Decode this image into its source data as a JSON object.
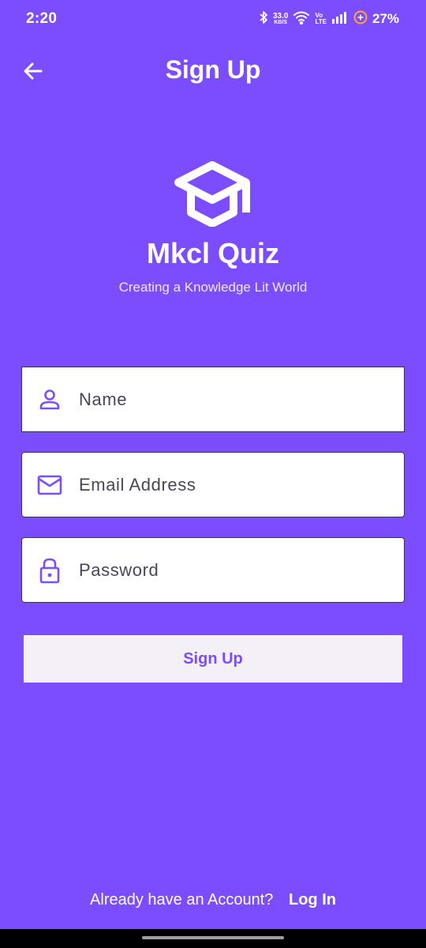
{
  "status_bar": {
    "time": "2:20",
    "net_speed": "33.0",
    "net_speed_unit": "KB/S",
    "volte_top": "Vo",
    "volte_bottom": "LTE",
    "battery": "27%",
    "icons": [
      "bluetooth-icon",
      "wifi-icon",
      "volte-icon",
      "signal-icon",
      "battery-saver-icon"
    ]
  },
  "app_bar": {
    "back_icon": "arrow-left-icon",
    "title": "Sign Up"
  },
  "brand": {
    "logo_icon": "graduation-cap-icon",
    "name": "Mkcl Quiz",
    "tagline": "Creating a Knowledge Lit World"
  },
  "form": {
    "name": {
      "placeholder": "Name",
      "value": "",
      "icon": "person-icon"
    },
    "email": {
      "placeholder": "Email Address",
      "value": "",
      "icon": "mail-icon"
    },
    "password": {
      "placeholder": "Password",
      "value": "",
      "icon": "lock-icon"
    },
    "submit_label": "Sign Up"
  },
  "footer": {
    "question": "Already have an Account?",
    "login_label": "Log In"
  },
  "colors": {
    "background": "#7c4dff",
    "accent": "#7c4dff",
    "field_background": "#ffffff",
    "button_background": "#f5eff7"
  }
}
